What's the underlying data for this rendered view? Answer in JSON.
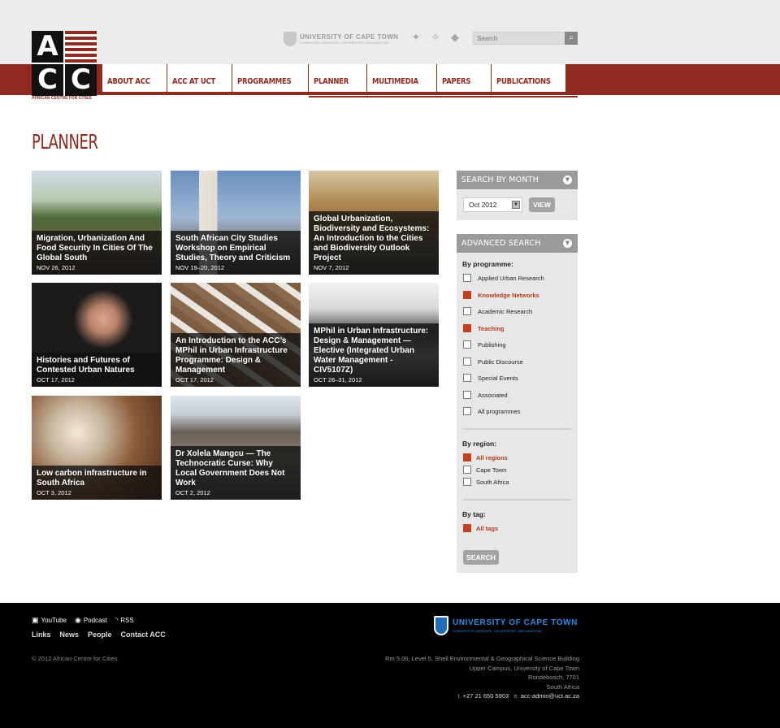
{
  "logo": {
    "letters": [
      "A",
      "C",
      "C"
    ],
    "tagline": "AFRICAN CENTRE FOR CITIES"
  },
  "topbar": {
    "university_name": "UNIVERSITY OF CAPE TOWN",
    "university_subtitle": "IYUNIVESITHI YASEKAPA · UNIVERSITEIT VAN KAAPSTAD",
    "search_placeholder": "Search",
    "social_icons": [
      "map-icon",
      "twitter-icon",
      "africa-icon"
    ]
  },
  "nav": {
    "items": [
      {
        "label": "ABOUT ACC"
      },
      {
        "label": "ACC AT UCT"
      },
      {
        "label": "PROGRAMMES"
      },
      {
        "label": "PLANNER"
      },
      {
        "label": "MULTIMEDIA"
      },
      {
        "label": "PAPERS"
      },
      {
        "label": "PUBLICATIONS"
      }
    ],
    "active": "PLANNER"
  },
  "page": {
    "title": "PLANNER"
  },
  "cards": [
    {
      "title": "Migration, Urbanization And Food Security In Cities Of The Global South",
      "date": "NOV 26, 2012"
    },
    {
      "title": "South African City Studies Workshop on Empirical Studies, Theory and Criticism",
      "date": "NOV 19–20, 2012"
    },
    {
      "title": "Global Urbanization, Biodiversity and Ecosystems: An Introduction to the Cities and Biodiversity Outlook Project",
      "date": "NOV 7, 2012"
    },
    {
      "title": "Histories and Futures of Contested Urban Natures",
      "date": "OCT 17, 2012"
    },
    {
      "title": "An Introduction to the ACC’s MPhil in Urban Infrastructure Programme: Design & Management",
      "date": "OCT 17, 2012"
    },
    {
      "title": "MPhil in Urban Infrastructure: Design & Management — Elective (Integrated Urban Water Management - CIV5107Z)",
      "date": "OCT 28–31, 2012"
    },
    {
      "title": "Low carbon infrastructure in South Africa",
      "date": "OCT 3, 2012"
    },
    {
      "title": "Dr Xolela Mangcu — The Technocratic Curse: Why Local Government Does Not Work",
      "date": "OCT 2, 2012"
    }
  ],
  "sidebar": {
    "month": {
      "heading": "SEARCH BY MONTH",
      "selected": "Oct 2012",
      "button": "VIEW"
    },
    "advanced": {
      "heading": "ADVANCED SEARCH",
      "programme_label": "By programme:",
      "programmes": [
        {
          "label": "Applied Urban Research",
          "checked": false
        },
        {
          "label": "Knowledge Networks",
          "checked": true
        },
        {
          "label": "Academic Research",
          "checked": false
        },
        {
          "label": "Teaching",
          "checked": true
        },
        {
          "label": "Publishing",
          "checked": false
        },
        {
          "label": "Public Discourse",
          "checked": false
        },
        {
          "label": "Special Events",
          "checked": false
        },
        {
          "label": "Associated",
          "checked": false
        },
        {
          "label": "All programmes",
          "checked": false
        }
      ],
      "region_label": "By region:",
      "regions": [
        {
          "label": "All regions",
          "checked": true
        },
        {
          "label": "Cape Town",
          "checked": false
        },
        {
          "label": "South Africa",
          "checked": false
        }
      ],
      "tag_label": "By tag:",
      "tags": [
        {
          "label": "All tags",
          "checked": true
        }
      ],
      "button": "SEARCH"
    }
  },
  "footer": {
    "social": [
      {
        "label": "YouTube",
        "icon": "youtube-icon"
      },
      {
        "label": "Podcast",
        "icon": "podcast-icon"
      },
      {
        "label": "RSS",
        "icon": "rss-icon"
      }
    ],
    "links": [
      "Links",
      "News",
      "People",
      "Contact ACC"
    ],
    "copyright": "© 2012 African Centre for Cities",
    "university_name": "UNIVERSITY OF CAPE TOWN",
    "university_subtitle": "IYUNIVESITHI YASEKAPA · UNIVERSITEIT VAN KAAPSTAD",
    "address": [
      "Rm 5.06, Level 5, Shell Environmental & Geographical Science Building",
      "Upper Campus, University of Cape Town",
      "Rondebosch, 7701",
      "South Africa"
    ],
    "phone_prefix": "t. ",
    "phone": "+27 21 650 5903",
    "email_prefix": "e. ",
    "email": "acc-admin@uct.ac.za"
  },
  "colors": {
    "brand_red": "#8e2a1e",
    "checked_orange": "#c0401f",
    "panel_grey": "#e7e7e7",
    "panel_head": "#9b9b9b"
  }
}
